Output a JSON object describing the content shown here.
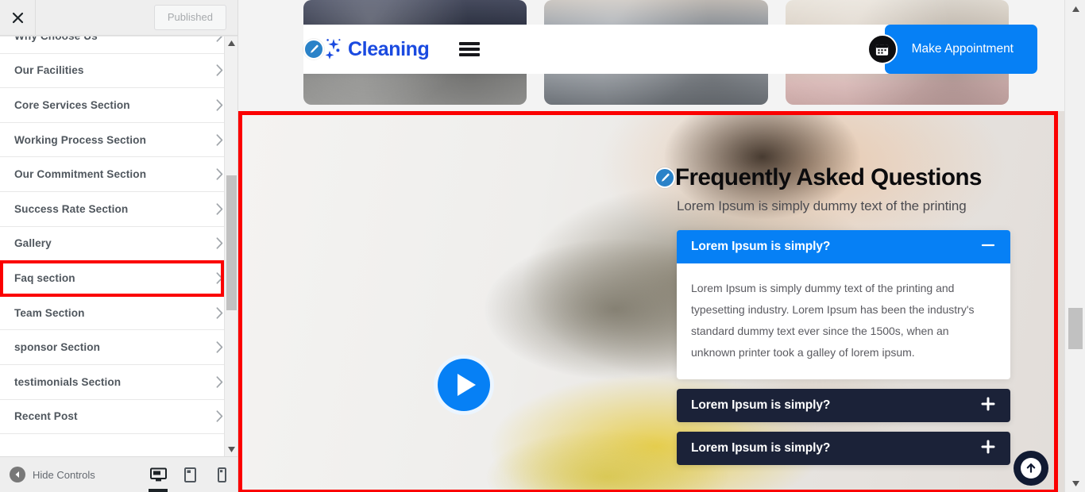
{
  "customizer": {
    "close_label": "Close",
    "publish_button": "Published",
    "hide_controls_label": "Hide Controls",
    "devices": [
      {
        "name": "desktop",
        "label": "Desktop",
        "active": true
      },
      {
        "name": "tablet",
        "label": "Tablet",
        "active": false
      },
      {
        "name": "mobile",
        "label": "Mobile",
        "active": false
      }
    ],
    "sections": [
      {
        "label": "Why Choose Us",
        "highlighted": false
      },
      {
        "label": "Our Facilities",
        "highlighted": false
      },
      {
        "label": "Core Services Section",
        "highlighted": false
      },
      {
        "label": "Working Process Section",
        "highlighted": false
      },
      {
        "label": "Our Commitment Section",
        "highlighted": false
      },
      {
        "label": "Success Rate Section",
        "highlighted": false
      },
      {
        "label": "Gallery",
        "highlighted": false
      },
      {
        "label": "Faq section",
        "highlighted": true
      },
      {
        "label": "Team Section",
        "highlighted": false
      },
      {
        "label": "sponsor Section",
        "highlighted": false
      },
      {
        "label": "testimonials Section",
        "highlighted": false
      },
      {
        "label": "Recent Post",
        "highlighted": false
      }
    ]
  },
  "site": {
    "brand_name": "Cleaning",
    "brand_color": "#1a4ae0",
    "accent_color": "#0680f5",
    "dark_color": "#1b2238",
    "appointment_button": "Make Appointment",
    "menu_icon": "hamburger-icon",
    "search_icon": "search-icon",
    "calendar_icon": "calendar-icon"
  },
  "faq": {
    "title": "Frequently Asked Questions",
    "subtitle": "Lorem Ipsum is simply dummy text of the printing",
    "items": [
      {
        "question": "Lorem Ipsum is simply?",
        "answer": "Lorem Ipsum is simply dummy text of the printing and typesetting industry. Lorem Ipsum has been the industry's standard dummy text ever since the 1500s, when an unknown printer took a galley of lorem ipsum.",
        "open": true,
        "toggle_icon": "minus-icon"
      },
      {
        "question": "Lorem Ipsum is simply?",
        "answer": "",
        "open": false,
        "toggle_icon": "plus-icon"
      },
      {
        "question": "Lorem Ipsum is simply?",
        "answer": "",
        "open": false,
        "toggle_icon": "plus-icon"
      }
    ],
    "play_button": "play-icon",
    "scroll_top_button": "arrow-up-icon"
  }
}
